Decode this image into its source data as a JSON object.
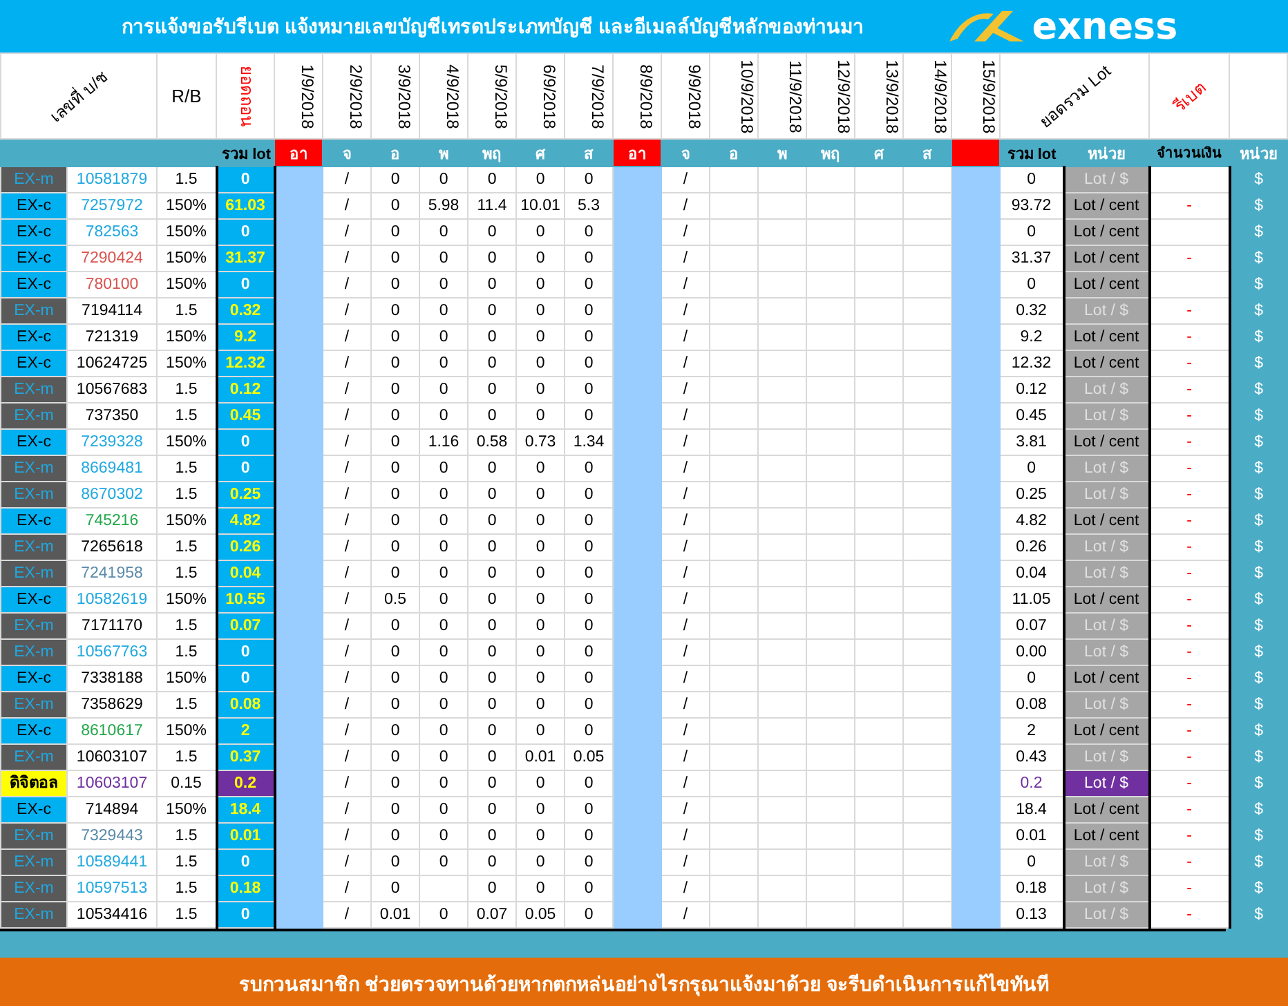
{
  "title": "การแจ้งขอรับรีเบต   แจ้งหมายเลขบัญชีเทรดประเภทบัญชี และอีเมลล์บัญชีหลักของท่านมา",
  "logo": "exness",
  "headers": {
    "account": "เลขที่ บ/ช",
    "rb": "R/B",
    "withdraw": "ยอดถอน",
    "sum": "ยอดรวม Lot",
    "rebate": "รีเบต"
  },
  "subheaders": {
    "total": "รวม lot",
    "sum": "รวม lot",
    "unit": "หน่วย",
    "money": "จำนวนเงิน",
    "unit2": "หน่วย"
  },
  "days": [
    {
      "date": "1/9/2018",
      "weekday": "อา",
      "holiday": true
    },
    {
      "date": "2/9/2018",
      "weekday": "จ",
      "holiday": false
    },
    {
      "date": "3/9/2018",
      "weekday": "อ",
      "holiday": false
    },
    {
      "date": "4/9/2018",
      "weekday": "พ",
      "holiday": false
    },
    {
      "date": "5/9/2018",
      "weekday": "พฤ",
      "holiday": false
    },
    {
      "date": "6/9/2018",
      "weekday": "ศ",
      "holiday": false
    },
    {
      "date": "7/9/2018",
      "weekday": "ส",
      "holiday": false
    },
    {
      "date": "8/9/2018",
      "weekday": "อา",
      "holiday": true
    },
    {
      "date": "9/9/2018",
      "weekday": "จ",
      "holiday": false
    },
    {
      "date": "10/9/2018",
      "weekday": "อ",
      "holiday": false
    },
    {
      "date": "11/9/2018",
      "weekday": "พ",
      "holiday": false
    },
    {
      "date": "12/9/2018",
      "weekday": "พฤ",
      "holiday": false
    },
    {
      "date": "13/9/2018",
      "weekday": "ศ",
      "holiday": false
    },
    {
      "date": "14/9/2018",
      "weekday": "ส",
      "holiday": false
    },
    {
      "date": "15/9/2018",
      "holiday": true
    }
  ],
  "rows": [
    {
      "kind": "m",
      "type": "EX-m",
      "account": "10581879",
      "color": "#1fa8e0",
      "rb": "1.5",
      "total": "0",
      "total_hl": false,
      "marks": [
        "/",
        "/"
      ],
      "values": [
        {
          "text": "0"
        },
        {
          "text": "0"
        },
        {
          "text": "0"
        },
        {
          "text": "0"
        },
        {
          "text": "0"
        }
      ],
      "sum": "0",
      "unit": "Lot / $",
      "unit_dim": true,
      "unit2": "$"
    },
    {
      "kind": "c",
      "type": "EX-c",
      "account": "7257972",
      "color": "#1fa8e0",
      "rb": "150%",
      "total": "61.03",
      "total_hl": true,
      "marks": [
        "/",
        "/"
      ],
      "values": [
        {
          "text": "0"
        },
        {
          "text": "5.98"
        },
        {
          "text": "11.4"
        },
        {
          "text": "10.01"
        },
        {
          "text": "5.3"
        }
      ],
      "sum": "93.72",
      "unit": "Lot / cent",
      "unit_dim": false,
      "money": "-",
      "unit2": "$"
    },
    {
      "kind": "c",
      "type": "EX-c",
      "account": "782563",
      "color": "#1fa8e0",
      "rb": "150%",
      "total": "0",
      "total_hl": false,
      "marks": [
        "/",
        "/"
      ],
      "values": [
        {
          "text": "0"
        },
        {
          "text": "0"
        },
        {
          "text": "0"
        },
        {
          "text": "0"
        },
        {
          "text": "0"
        }
      ],
      "sum": "0",
      "unit": "Lot / cent",
      "unit_dim": false,
      "unit2": "$"
    },
    {
      "kind": "c",
      "type": "EX-c",
      "account": "7290424",
      "color": "#d9534f",
      "rb": "150%",
      "total": "31.37",
      "total_hl": true,
      "marks": [
        "/",
        "/"
      ],
      "values": [
        {
          "text": "0"
        },
        {
          "text": "0"
        },
        {
          "text": "0"
        },
        {
          "text": "0"
        },
        {
          "text": "0"
        }
      ],
      "sum": "31.37",
      "unit": "Lot / cent",
      "unit_dim": false,
      "money": "-",
      "unit2": "$"
    },
    {
      "kind": "c",
      "type": "EX-c",
      "account": "780100",
      "color": "#d9534f",
      "rb": "150%",
      "total": "0",
      "total_hl": false,
      "marks": [
        "/",
        "/"
      ],
      "values": [
        {
          "text": "0"
        },
        {
          "text": "0"
        },
        {
          "text": "0"
        },
        {
          "text": "0"
        },
        {
          "text": "0"
        }
      ],
      "sum": "0",
      "unit": "Lot / cent",
      "unit_dim": false,
      "unit2": "$"
    },
    {
      "kind": "m",
      "type": "EX-m",
      "account": "7194114",
      "color": "#000000",
      "rb": "1.5",
      "total": "0.32",
      "total_hl": true,
      "marks": [
        "/",
        "/"
      ],
      "values": [
        {
          "text": "0"
        },
        {
          "text": "0"
        },
        {
          "text": "0"
        },
        {
          "text": "0"
        },
        {
          "text": "0"
        }
      ],
      "sum": "0.32",
      "unit": "Lot / $",
      "unit_dim": true,
      "money": "-",
      "unit2": "$"
    },
    {
      "kind": "c",
      "type": "EX-c",
      "account": "721319",
      "color": "#000000",
      "rb": "150%",
      "total": "9.2",
      "total_hl": true,
      "marks": [
        "/",
        "/"
      ],
      "values": [
        {
          "text": "0"
        },
        {
          "text": "0"
        },
        {
          "text": "0"
        },
        {
          "text": "0"
        },
        {
          "text": "0"
        }
      ],
      "sum": "9.2",
      "unit": "Lot / cent",
      "unit_dim": false,
      "money": "-",
      "unit2": "$"
    },
    {
      "kind": "c",
      "type": "EX-c",
      "account": "10624725",
      "color": "#000000",
      "rb": "150%",
      "total": "12.32",
      "total_hl": true,
      "marks": [
        "/",
        "/"
      ],
      "values": [
        {
          "text": "0"
        },
        {
          "text": "0"
        },
        {
          "text": "0"
        },
        {
          "text": "0"
        },
        {
          "text": "0"
        }
      ],
      "sum": "12.32",
      "unit": "Lot / cent",
      "unit_dim": false,
      "money": "-",
      "unit2": "$"
    },
    {
      "kind": "m",
      "type": "EX-m",
      "account": "10567683",
      "color": "#000000",
      "rb": "1.5",
      "total": "0.12",
      "total_hl": true,
      "marks": [
        "/",
        "/"
      ],
      "values": [
        {
          "text": "0"
        },
        {
          "text": "0"
        },
        {
          "text": "0"
        },
        {
          "text": "0"
        },
        {
          "text": "0"
        }
      ],
      "sum": "0.12",
      "unit": "Lot / $",
      "unit_dim": true,
      "money": "-",
      "unit2": "$"
    },
    {
      "kind": "m",
      "type": "EX-m",
      "account": "737350",
      "color": "#000000",
      "rb": "1.5",
      "total": "0.45",
      "total_hl": true,
      "marks": [
        "/",
        "/"
      ],
      "values": [
        {
          "text": "0"
        },
        {
          "text": "0"
        },
        {
          "text": "0"
        },
        {
          "text": "0"
        },
        {
          "text": "0"
        }
      ],
      "sum": "0.45",
      "unit": "Lot / $",
      "unit_dim": true,
      "money": "-",
      "unit2": "$"
    },
    {
      "kind": "c",
      "type": "EX-c",
      "account": "7239328",
      "color": "#1fa8e0",
      "rb": "150%",
      "total": "0",
      "total_hl": false,
      "marks": [
        "/",
        "/"
      ],
      "values": [
        {
          "text": "0"
        },
        {
          "text": "1.16"
        },
        {
          "text": "0.58"
        },
        {
          "text": "0.73"
        },
        {
          "text": "1.34"
        }
      ],
      "sum": "3.81",
      "unit": "Lot / cent",
      "unit_dim": false,
      "money": "-",
      "unit2": "$"
    },
    {
      "kind": "m",
      "type": "EX-m",
      "account": "8669481",
      "color": "#1fa8e0",
      "rb": "1.5",
      "total": "0",
      "total_hl": false,
      "marks": [
        "/",
        "/"
      ],
      "values": [
        {
          "text": "0"
        },
        {
          "text": "0"
        },
        {
          "text": "0"
        },
        {
          "text": "0"
        },
        {
          "text": "0"
        }
      ],
      "sum": "0",
      "unit": "Lot / $",
      "unit_dim": true,
      "money": "-",
      "unit2": "$"
    },
    {
      "kind": "m",
      "type": "EX-m",
      "account": "8670302",
      "color": "#1fa8e0",
      "rb": "1.5",
      "total": "0.25",
      "total_hl": true,
      "marks": [
        "/",
        "/"
      ],
      "values": [
        {
          "text": "0"
        },
        {
          "text": "0"
        },
        {
          "text": "0"
        },
        {
          "text": "0"
        },
        {
          "text": "0"
        }
      ],
      "sum": "0.25",
      "unit": "Lot / $",
      "unit_dim": true,
      "money": "-",
      "unit2": "$"
    },
    {
      "kind": "c",
      "type": "EX-c",
      "account": "745216",
      "color": "#22a84a",
      "rb": "150%",
      "total": "4.82",
      "total_hl": true,
      "marks": [
        "/",
        "/"
      ],
      "values": [
        {
          "text": "0"
        },
        {
          "text": "0"
        },
        {
          "text": "0"
        },
        {
          "text": "0"
        },
        {
          "text": "0"
        }
      ],
      "sum": "4.82",
      "unit": "Lot / cent",
      "unit_dim": false,
      "money": "-",
      "unit2": "$"
    },
    {
      "kind": "m",
      "type": "EX-m",
      "account": "7265618",
      "color": "#000000",
      "rb": "1.5",
      "total": "0.26",
      "total_hl": true,
      "marks": [
        "/",
        "/"
      ],
      "values": [
        {
          "text": "0"
        },
        {
          "text": "0"
        },
        {
          "text": "0"
        },
        {
          "text": "0"
        },
        {
          "text": "0"
        }
      ],
      "sum": "0.26",
      "unit": "Lot / $",
      "unit_dim": true,
      "money": "-",
      "unit2": "$"
    },
    {
      "kind": "m",
      "type": "EX-m",
      "account": "7241958",
      "color": "#5a8aa8",
      "rb": "1.5",
      "total": "0.04",
      "total_hl": true,
      "marks": [
        "/",
        "/"
      ],
      "values": [
        {
          "text": "0"
        },
        {
          "text": "0"
        },
        {
          "text": "0"
        },
        {
          "text": "0"
        },
        {
          "text": "0"
        }
      ],
      "sum": "0.04",
      "unit": "Lot / $",
      "unit_dim": true,
      "money": "-",
      "unit2": "$"
    },
    {
      "kind": "c",
      "type": "EX-c",
      "account": "10582619",
      "color": "#1fa8e0",
      "rb": "150%",
      "total": "10.55",
      "total_hl": true,
      "marks": [
        "/",
        "/"
      ],
      "values": [
        {
          "text": "0.5"
        },
        {
          "text": "0"
        },
        {
          "text": "0"
        },
        {
          "text": "0"
        },
        {
          "text": "0"
        }
      ],
      "sum": "11.05",
      "unit": "Lot / cent",
      "unit_dim": false,
      "money": "-",
      "unit2": "$"
    },
    {
      "kind": "m",
      "type": "EX-m",
      "account": "7171170",
      "color": "#000000",
      "rb": "1.5",
      "total": "0.07",
      "total_hl": true,
      "marks": [
        "/",
        "/"
      ],
      "values": [
        {
          "text": "0"
        },
        {
          "text": "0"
        },
        {
          "text": "0"
        },
        {
          "text": "0"
        },
        {
          "text": "0"
        }
      ],
      "sum": "0.07",
      "unit": "Lot / $",
      "unit_dim": true,
      "money": "-",
      "unit2": "$"
    },
    {
      "kind": "m",
      "type": "EX-m",
      "account": "10567763",
      "color": "#1fa8e0",
      "rb": "1.5",
      "total": "0",
      "total_hl": false,
      "marks": [
        "/",
        "/"
      ],
      "values": [
        {
          "text": "0"
        },
        {
          "text": "0"
        },
        {
          "text": "0"
        },
        {
          "text": "0"
        },
        {
          "text": "0"
        }
      ],
      "sum": "0.00",
      "unit": "Lot / $",
      "unit_dim": true,
      "money": "-",
      "unit2": "$"
    },
    {
      "kind": "c",
      "type": "EX-c",
      "account": "7338188",
      "color": "#000000",
      "rb": "150%",
      "total": "0",
      "total_hl": false,
      "marks": [
        "/",
        "/"
      ],
      "values": [
        {
          "text": "0"
        },
        {
          "text": "0"
        },
        {
          "text": "0"
        },
        {
          "text": "0"
        },
        {
          "text": "0"
        }
      ],
      "sum": "0",
      "unit": "Lot / cent",
      "unit_dim": false,
      "money": "-",
      "unit2": "$"
    },
    {
      "kind": "m",
      "type": "EX-m",
      "account": "7358629",
      "color": "#000000",
      "rb": "1.5",
      "total": "0.08",
      "total_hl": true,
      "marks": [
        "/",
        "/"
      ],
      "values": [
        {
          "text": "0"
        },
        {
          "text": "0"
        },
        {
          "text": "0"
        },
        {
          "text": "0"
        },
        {
          "text": "0"
        }
      ],
      "sum": "0.08",
      "unit": "Lot / $",
      "unit_dim": true,
      "money": "-",
      "unit2": "$"
    },
    {
      "kind": "c",
      "type": "EX-c",
      "account": "8610617",
      "color": "#22a84a",
      "rb": "150%",
      "total": "2",
      "total_hl": true,
      "marks": [
        "/",
        "/"
      ],
      "values": [
        {
          "text": "0"
        },
        {
          "text": "0"
        },
        {
          "text": "0"
        },
        {
          "text": "0"
        },
        {
          "text": "0"
        }
      ],
      "sum": "2",
      "unit": "Lot / cent",
      "unit_dim": false,
      "money": "-",
      "unit2": "$"
    },
    {
      "kind": "m",
      "type": "EX-m",
      "account": "10603107",
      "color": "#000000",
      "rb": "1.5",
      "total": "0.37",
      "total_hl": true,
      "marks": [
        "/",
        "/"
      ],
      "values": [
        {
          "text": "0"
        },
        {
          "text": "0"
        },
        {
          "text": "0"
        },
        {
          "text": "0.01"
        },
        {
          "text": "0.05"
        }
      ],
      "sum": "0.43",
      "unit": "Lot / $",
      "unit_dim": true,
      "money": "-",
      "unit2": "$"
    },
    {
      "kind": "digital",
      "type": "ดิจิตอล",
      "account": "10603107",
      "color": "#7030a0",
      "rb": "0.15",
      "total": "0.2",
      "total_hl": true,
      "marks": [
        "/",
        "/"
      ],
      "values": [
        {
          "text": "0"
        },
        {
          "text": "0"
        },
        {
          "text": "0"
        },
        {
          "text": "0"
        },
        {
          "text": "0"
        }
      ],
      "sum": "0.2",
      "unit": "Lot / $",
      "unit_dim": false,
      "money": "-",
      "unit2": "$"
    },
    {
      "kind": "c",
      "type": "EX-c",
      "account": "714894",
      "color": "#000000",
      "rb": "150%",
      "total": "18.4",
      "total_hl": true,
      "marks": [
        "/",
        "/"
      ],
      "values": [
        {
          "text": "0"
        },
        {
          "text": "0"
        },
        {
          "text": "0"
        },
        {
          "text": "0"
        },
        {
          "text": "0"
        }
      ],
      "sum": "18.4",
      "unit": "Lot / cent",
      "unit_dim": false,
      "money": "-",
      "unit2": "$"
    },
    {
      "kind": "m",
      "type": "EX-m",
      "account": "7329443",
      "color": "#5a8aa8",
      "rb": "1.5",
      "total": "0.01",
      "total_hl": true,
      "marks": [
        "/",
        "/"
      ],
      "values": [
        {
          "text": "0"
        },
        {
          "text": "0"
        },
        {
          "text": "0"
        },
        {
          "text": "0"
        },
        {
          "text": "0"
        }
      ],
      "sum": "0.01",
      "unit": "Lot / cent",
      "unit_dim": false,
      "money": "-",
      "unit2": "$"
    },
    {
      "kind": "m",
      "type": "EX-m",
      "account": "10589441",
      "color": "#1fa8e0",
      "rb": "1.5",
      "total": "0",
      "total_hl": false,
      "marks": [
        "/",
        "/"
      ],
      "values": [
        {
          "text": "0"
        },
        {
          "text": "0"
        },
        {
          "text": "0"
        },
        {
          "text": "0"
        },
        {
          "text": "0"
        }
      ],
      "sum": "0",
      "unit": "Lot / $",
      "unit_dim": true,
      "money": "-",
      "unit2": "$"
    },
    {
      "kind": "m",
      "type": "EX-m",
      "account": "10597513",
      "color": "#1fa8e0",
      "rb": "1.5",
      "total": "0.18",
      "total_hl": true,
      "marks": [
        "/",
        "/"
      ],
      "values": [
        {
          "text": "0"
        },
        {
          "blank": true
        },
        {
          "text": "0"
        },
        {
          "text": "0"
        },
        {
          "text": "0"
        }
      ],
      "sum": "0.18",
      "unit": "Lot / $",
      "unit_dim": true,
      "money": "-",
      "unit2": "$"
    },
    {
      "kind": "m",
      "type": "EX-m",
      "account": "10534416",
      "color": "#000000",
      "rb": "1.5",
      "total": "0",
      "total_hl": false,
      "marks": [
        "/",
        "/"
      ],
      "values": [
        {
          "text": "0.01"
        },
        {
          "text": "0"
        },
        {
          "text": "0.07"
        },
        {
          "text": "0.05"
        },
        {
          "text": "0"
        }
      ],
      "sum": "0.13",
      "unit": "Lot / $",
      "unit_dim": true,
      "money": "-",
      "unit2": "$"
    }
  ],
  "footer": "รบกวนสมาชิก ช่วยตรวจทานด้วยหากตกหล่นอย่างไรกรุณาแจ้งมาด้วย จะรีบดำเนินการแก้ไขทันที"
}
